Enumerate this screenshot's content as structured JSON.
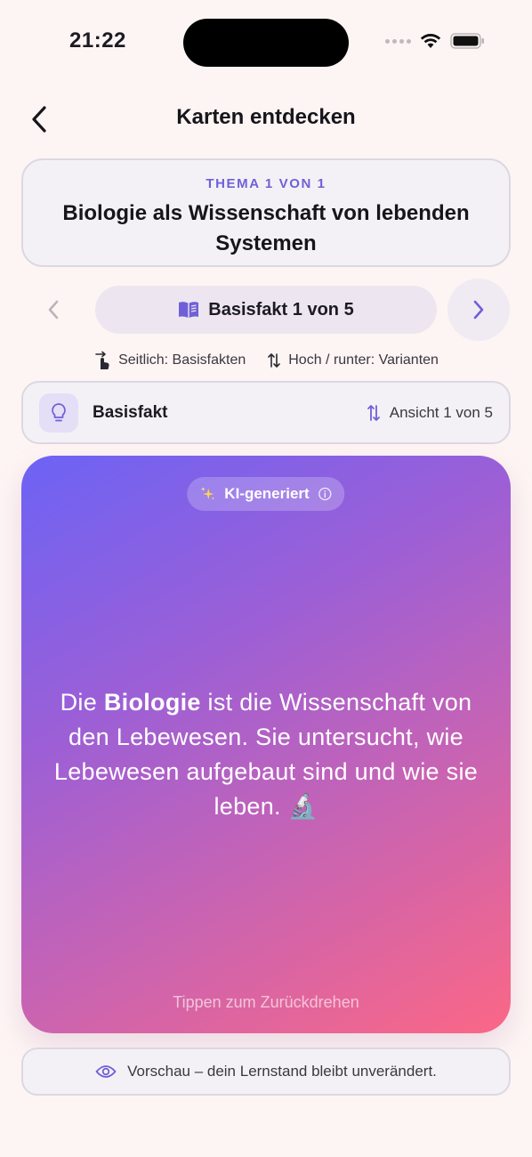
{
  "status_bar": {
    "time": "21:22"
  },
  "header": {
    "title": "Karten entdecken"
  },
  "topic": {
    "eyebrow": "THEMA 1 VON 1",
    "title": "Biologie als Wissenschaft von lebenden Systemen"
  },
  "navigation": {
    "fact_label": "Basisfakt 1 von 5"
  },
  "hints": {
    "sideways": "Seitlich: Basisfakten",
    "updown": "Hoch / runter: Varianten"
  },
  "view_bar": {
    "label": "Basisfakt",
    "counter": "Ansicht 1 von 5"
  },
  "card": {
    "badge": "KI-generiert",
    "text_before": "Die ",
    "text_bold": "Biologie",
    "text_after": " ist die Wissenschaft von den Lebewesen. Sie untersucht, wie Lebewesen aufgebaut sind und wie sie leben. 🔬",
    "flip_hint": "Tippen zum Zurückdrehen"
  },
  "preview": {
    "text": "Vorschau – dein Lernstand bleibt unverändert."
  },
  "colors": {
    "accent": "#6f60d8",
    "card_gradient_start": "#6c63f5",
    "card_gradient_end": "#fb6786",
    "background": "#fdf5f3"
  },
  "icons": {
    "back": "chevron-left-icon",
    "prev": "chevron-left-icon",
    "next": "chevron-right-icon",
    "fact": "open-book-icon",
    "swipe_side": "swipe-hand-icon",
    "swipe_updown": "up-down-arrows-icon",
    "view": "lightbulb-icon",
    "badge": "sparkles-icon",
    "info": "info-icon",
    "preview": "eye-icon"
  }
}
